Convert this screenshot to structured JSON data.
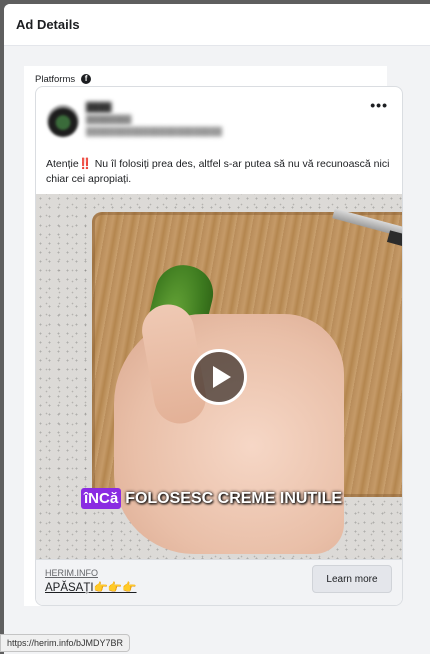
{
  "dialog": {
    "title": "Ad Details"
  },
  "platforms": {
    "label": "Platforms",
    "icon": "facebook-icon"
  },
  "ad": {
    "more_label": "•••",
    "text_part1": "Atenție",
    "excl": "‼️",
    "text_part2": " Nu îl folosiți prea des, altfel s-ar putea să nu vă recunoască nici chiar cei apropiați.",
    "video": {
      "caption_badge": "îNCă",
      "caption_text": "FOLOSESC CREME INUTILE"
    },
    "footer": {
      "domain": "HERIM.INFO",
      "headline": "APĂSAȚI👉👉👉",
      "cta_label": "Learn more"
    }
  },
  "status_bar": {
    "url": "https://herim.info/bJMDY7BR"
  }
}
